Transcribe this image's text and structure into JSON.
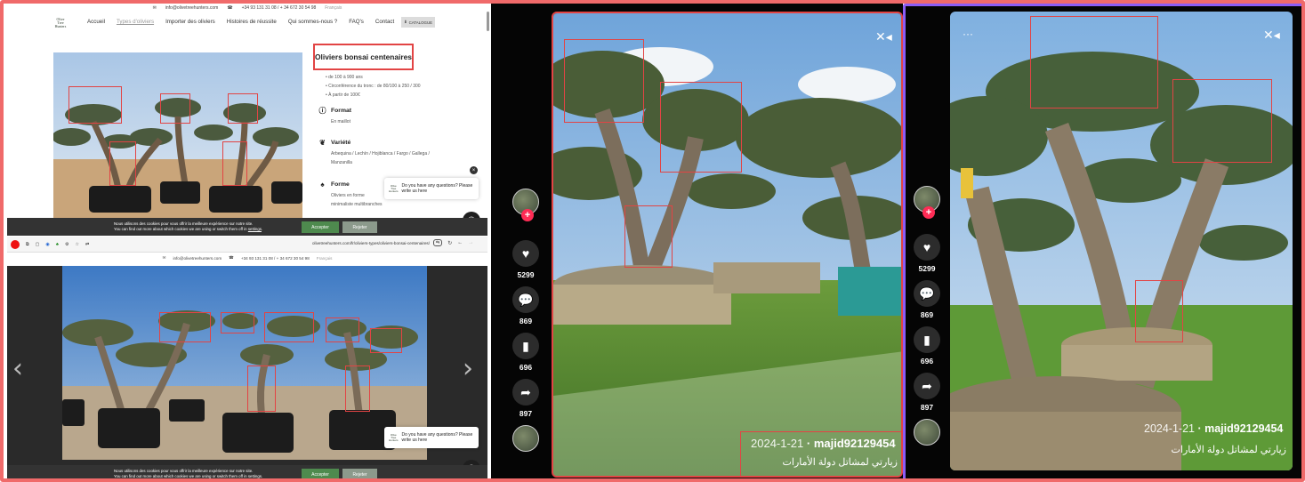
{
  "website": {
    "topbar": {
      "email": "info@olivetreehunters.com",
      "phones": "+34 93 131 31 08 / + 34 672 30 54 98",
      "lang": "Français"
    },
    "logo_lines": [
      "Olive",
      "Tree",
      "Hunters"
    ],
    "nav": [
      "Accueil",
      "Types d'oliviers",
      "Importer des oliviers",
      "Histoires de réussite",
      "Qui sommes-nous ?",
      "FAQ's",
      "Contact"
    ],
    "catalogue_label": "CATALOGUE",
    "product": {
      "title": "Oliviers bonsai centenaires",
      "bullets": [
        "de 100 à 900 ans",
        "Circonférence du tronc : de 80/100 à 250 / 300",
        "À partir de 100€"
      ],
      "specs": [
        {
          "label": "Format",
          "value": "En maillot",
          "icon": "info-icon"
        },
        {
          "label": "Variété",
          "value": "Arbequina / Lechín / Hojiblanca / Fargo / Gallega / Manzanilla",
          "icon": "leaf-icon"
        },
        {
          "label": "Forme",
          "value": "Oliviers en forme minimaliste multibranches",
          "icon": "tree-icon"
        }
      ]
    },
    "chat": {
      "text": "Do you have any questions? Please write us here"
    },
    "cookie": {
      "line1": "Nous utilisons des cookies pour vous offrir la meilleure expérience sur notre site.",
      "line2": "You can find out more about which cookies we are using or switch them off in",
      "link": "settings",
      "accept": "Accepter",
      "reject": "Rejeter"
    },
    "browser": {
      "url": "olivetreehunters.com/fr/oliviers-types/oliviers-bonsai-centenaires/"
    },
    "gallery_prev": "‹",
    "gallery_next": "›"
  },
  "tiktok1": {
    "likes": "5299",
    "comments": "869",
    "saves": "696",
    "shares": "897",
    "date": "2024-1-21",
    "user": "majid92129454",
    "caption": "زيارتي لمشاتل دولة الأمارات"
  },
  "tiktok2": {
    "likes": "5299",
    "comments": "869",
    "saves": "696",
    "shares": "897",
    "date": "2024-1-21",
    "user": "majid92129454",
    "caption": "زيارتي لمشاتل دولة الأمارات",
    "more": "···"
  },
  "colors": {
    "highlight": "#e24444",
    "frame": "#f06a6a",
    "purple_frame": "#8b5cf6",
    "tiktok_plus": "#fe2c55"
  }
}
